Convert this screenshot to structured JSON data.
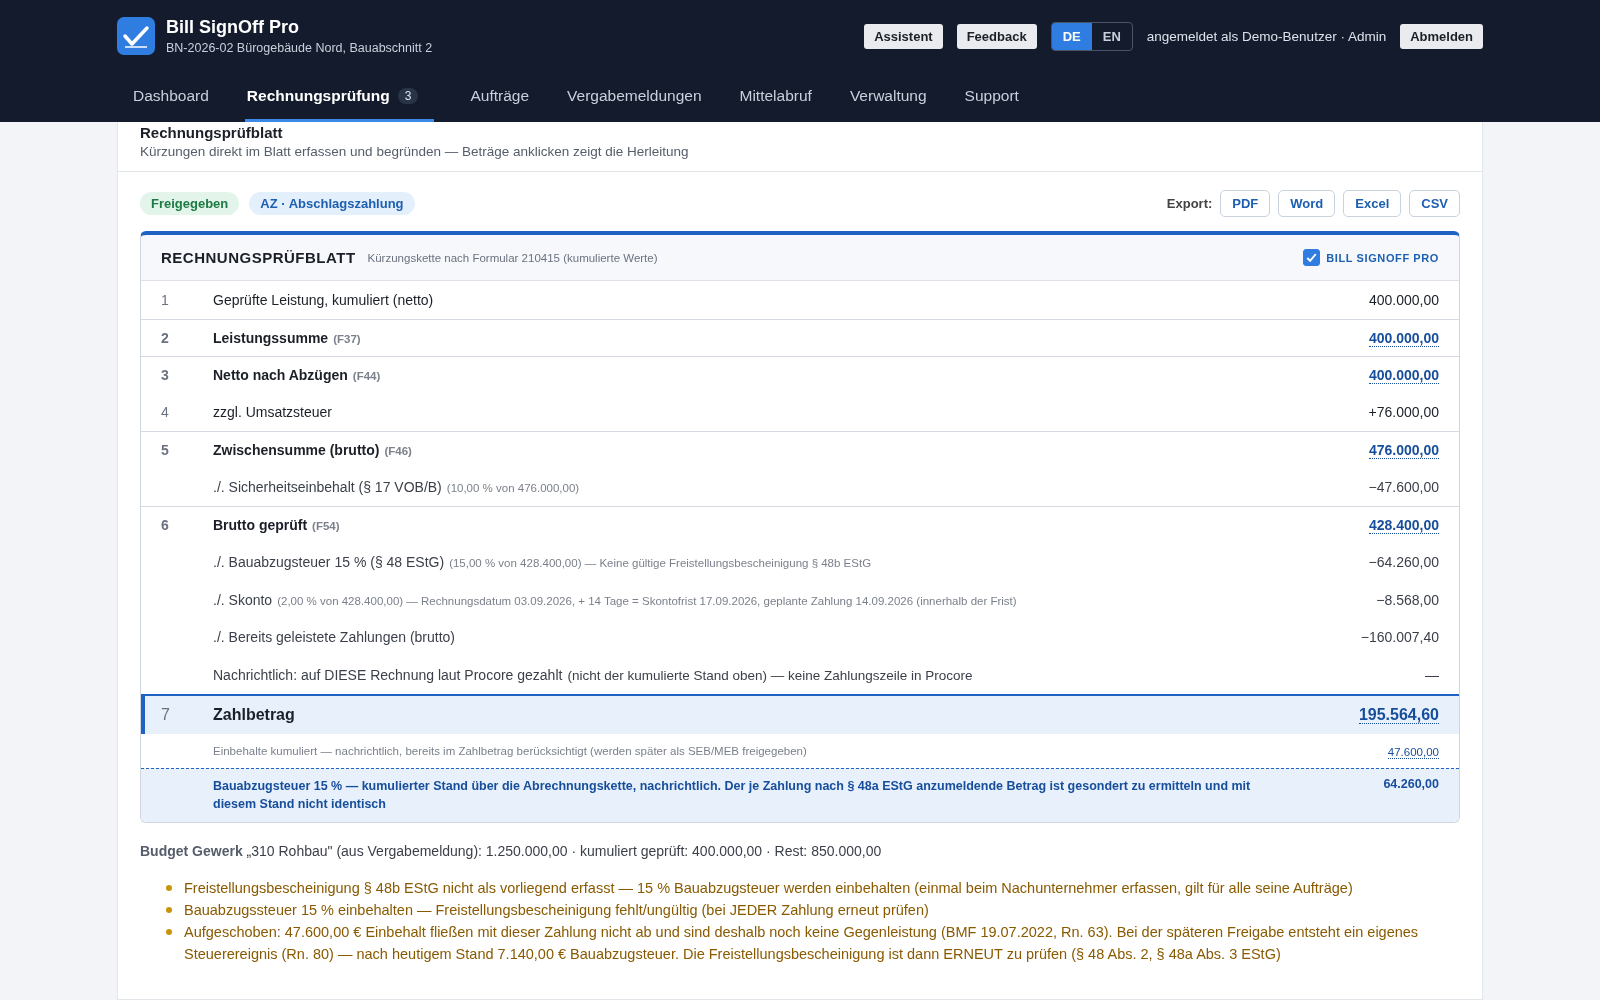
{
  "app": {
    "name": "Bill SignOff Pro",
    "project": "BN-2026-02 Bürogebäude Nord, Bauabschnitt 2"
  },
  "header_buttons": [
    "Assistent",
    "Feedback"
  ],
  "languages": [
    {
      "label": "DE",
      "selected": true
    },
    {
      "label": "EN",
      "selected": false
    }
  ],
  "user": "angemeldet als Demo-Benutzer · Admin",
  "logout": "Abmelden",
  "nav": [
    {
      "label": "Dashboard",
      "selected": false
    },
    {
      "label": "Rechnungsprüfung",
      "selected": true,
      "badge": "3"
    },
    {
      "label": "Aufträge",
      "selected": false
    },
    {
      "label": "Vergabemeldungen",
      "selected": false
    },
    {
      "label": "Mittelabruf",
      "selected": false
    },
    {
      "label": "Verwaltung",
      "selected": false
    },
    {
      "label": "Support",
      "selected": false
    }
  ],
  "page": {
    "title": "Rechnungsprüfblatt",
    "subtitle": "Kürzungen direkt im Blatt erfassen und begründen — Beträge anklicken zeigt die Herleitung"
  },
  "tags": [
    {
      "label": "Freigegeben",
      "kind": "status"
    },
    {
      "label": "AZ · Abschlagszahlung",
      "kind": "type"
    }
  ],
  "export": {
    "label": "Export:",
    "buttons": [
      "PDF",
      "Word",
      "Excel",
      "CSV"
    ]
  },
  "sheet": {
    "title": "RECHNUNGSPRÜFBLATT",
    "subtitle": "Kürzungskette nach Formular 210415 (kumulierte Werte)",
    "brand": "BILL SIGNOFF PRO",
    "brand_checked": true,
    "rows": [
      {
        "kind": "plain",
        "number": "1",
        "label": "Geprüfte Leistung, kumuliert (netto)",
        "amount": "400.000,00"
      },
      {
        "kind": "sum",
        "number": "2",
        "label": "Leistungssumme",
        "ref": "(F37)",
        "amount": "400.000,00"
      },
      {
        "kind": "sum",
        "number": "3",
        "label": "Netto nach Abzügen",
        "ref": "(F44)",
        "amount": "400.000,00"
      },
      {
        "kind": "plain",
        "number": "4",
        "label": "zzgl. Umsatzsteuer",
        "amount": "+76.000,00"
      },
      {
        "kind": "sum",
        "number": "5",
        "label": "Zwischensumme (brutto)",
        "ref": "(F46)",
        "amount": "476.000,00"
      },
      {
        "kind": "deduction",
        "label": "./. Sicherheitseinbehalt (§ 17 VOB/B)",
        "detail": "(10,00 % von 476.000,00)",
        "amount": "−47.600,00"
      },
      {
        "kind": "sum",
        "number": "6",
        "label": "Brutto geprüft",
        "ref": "(F54)",
        "amount": "428.400,00"
      },
      {
        "kind": "deduction",
        "label": "./. Bauabzugsteuer 15 % (§ 48 EStG)",
        "detail": "(15,00 % von 428.400,00) — Keine gültige Freistellungsbescheinigung § 48b EStG",
        "amount": "−64.260,00"
      },
      {
        "kind": "deduction",
        "label": "./. Skonto",
        "detail": "(2,00 % von 428.400,00) — Rechnungsdatum 03.09.2026, + 14 Tage = Skontofrist 17.09.2026, geplante Zahlung 14.09.2026 (innerhalb der Frist)",
        "amount": "−8.568,00"
      },
      {
        "kind": "deduction",
        "label": "./. Bereits geleistete Zahlungen (brutto)",
        "amount": "−160.007,40"
      },
      {
        "kind": "note",
        "label": "Nachrichtlich: auf DIESE Rechnung laut Procore gezahlt",
        "detail": "(nicht der kumulierte Stand oben) — keine Zahlungszeile in Procore",
        "amount": "—"
      },
      {
        "kind": "total",
        "number": "7",
        "label": "Zahlbetrag",
        "amount": "195.564,60"
      },
      {
        "kind": "retained",
        "label": "Einbehalte kumuliert — nachrichtlich, bereits im Zahlbetrag berücksichtigt (werden später als SEB/MEB freigegeben)",
        "amount": "47.600,00"
      },
      {
        "kind": "info",
        "label": "Bauabzugsteuer 15 % — kumulierter Stand über die Abrechnungskette, nachrichtlich. Der je Zahlung nach § 48a EStG anzumeldende Betrag ist gesondert zu ermitteln und mit diesem Stand nicht identisch",
        "amount": "64.260,00"
      }
    ]
  },
  "budget": "**Budget Gewerk** „310 Rohbau\" (aus Vergabemeldung): 1.250.000,00 · kumuliert geprüft: 400.000,00 · Rest: 850.000,00",
  "warnings": [
    "Freistellungsbescheinigung § 48b EStG nicht als vorliegend erfasst — 15 % Bauabzugsteuer werden einbehalten (einmal beim Nachunternehmer erfassen, gilt für alle seine Aufträge)",
    "Bauabzugssteuer 15 % einbehalten — Freistellungsbescheinigung fehlt/ungültig (bei JEDER Zahlung erneut prüfen)",
    "Aufgeschoben: 47.600,00 € Einbehalt fließen mit dieser Zahlung nicht ab und sind deshalb noch keine Gegenleistung (BMF 19.07.2022, Rn. 63). Bei der späteren Freigabe entsteht ein eigenes Steuerereignis (Rn. 80) — nach heutigem Stand 7.140,00 € Bauabzugsteuer. Die Freistellungsbescheinigung ist dann ERNEUT zu prüfen (§ 48 Abs. 2, § 48a Abs. 3 EStG)"
  ]
}
